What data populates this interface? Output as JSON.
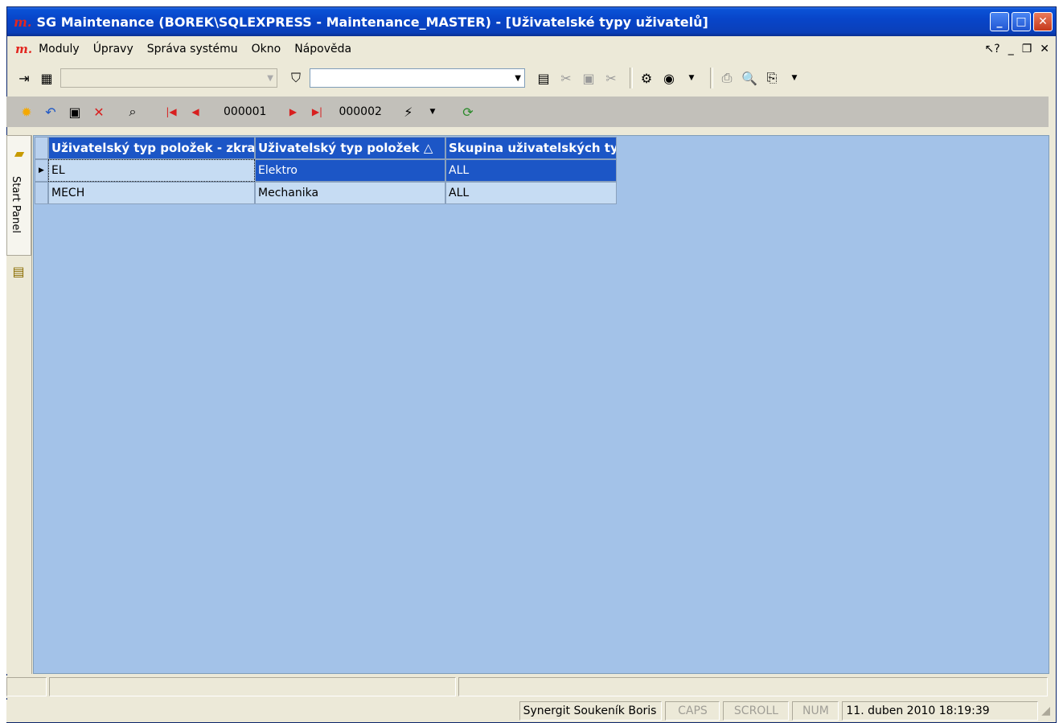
{
  "window": {
    "logo": "m.",
    "title": "SG Maintenance (BOREK\\SQLEXPRESS - Maintenance_MASTER) - [Uživatelské typy uživatelů]"
  },
  "menubar": {
    "logo": "m.",
    "items": [
      "Moduly",
      "Úpravy",
      "Správa systému",
      "Okno",
      "Nápověda"
    ]
  },
  "navigator": {
    "current_record": "000001",
    "total_records": "000002"
  },
  "sidebar": {
    "tab_label": "Start Panel"
  },
  "grid": {
    "columns": [
      "Uživatelský typ položek - zkratka",
      "Uživatelský typ položek △",
      "Skupina uživatelských typů"
    ],
    "rows": [
      [
        "EL",
        "Elektro",
        "ALL"
      ],
      [
        "MECH",
        "Mechanika",
        "ALL"
      ]
    ]
  },
  "statusbar": {
    "user": "Synergit Soukeník Boris",
    "caps": "CAPS",
    "scroll": "SCROLL",
    "num": "NUM",
    "datetime": "11. duben 2010 18:19:39"
  }
}
